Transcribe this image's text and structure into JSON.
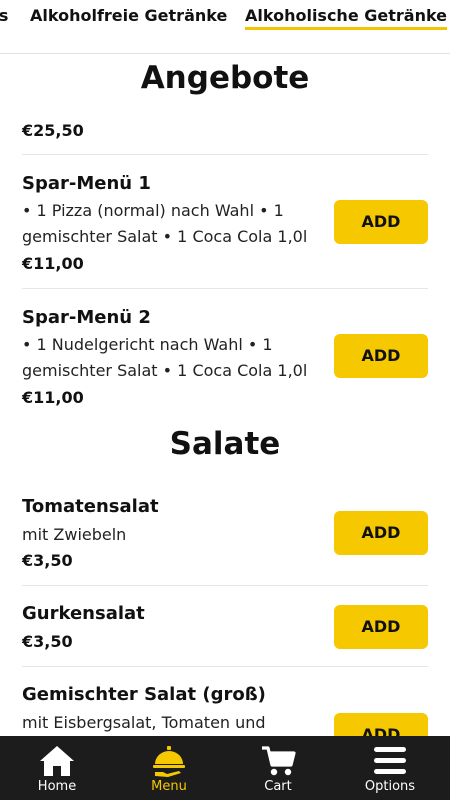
{
  "tabs": {
    "partial": "'s",
    "non_alcoholic": "Alkoholfreie Getränke",
    "alcoholic": "Alkoholische Getränke"
  },
  "sections": {
    "offers_title": "Angebote",
    "salads_title": "Salate"
  },
  "offers": {
    "prev_price": "€25,50",
    "item1": {
      "name": "Spar-Menü 1",
      "desc_line1": "• 1 Pizza (normal) nach Wahl • 1",
      "desc_line2": "gemischter Salat • 1 Coca Cola 1,0l",
      "price": "€11,00",
      "add": "ADD"
    },
    "item2": {
      "name": "Spar-Menü 2",
      "desc_line1": "• 1 Nudelgericht nach Wahl • 1",
      "desc_line2": "gemischter Salat • 1 Coca Cola 1,0l",
      "price": "€11,00",
      "add": "ADD"
    }
  },
  "salads": {
    "item1": {
      "name": "Tomatensalat",
      "desc": "mit Zwiebeln",
      "price": "€3,50",
      "add": "ADD"
    },
    "item2": {
      "name": "Gurkensalat",
      "price": "€3,50",
      "add": "ADD"
    },
    "item3": {
      "name": "Gemischter Salat (groß)",
      "desc": "mit Eisbergsalat, Tomaten und",
      "add": "ADD"
    }
  },
  "nav": {
    "home": "Home",
    "menu": "Menu",
    "cart": "Cart",
    "options": "Options"
  },
  "colors": {
    "accent": "#f5c800",
    "nav_bg": "#1c1c1c"
  }
}
